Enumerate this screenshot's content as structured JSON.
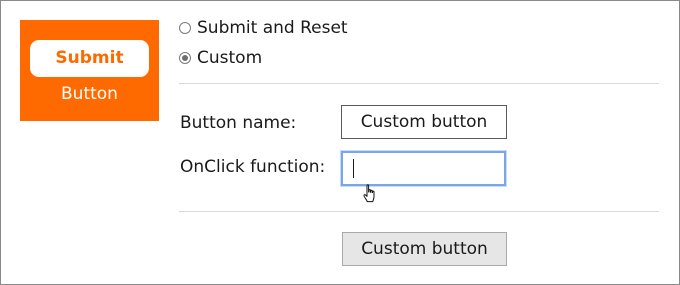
{
  "tile": {
    "pill_label": "Submit",
    "caption": "Button",
    "color": "#ff6a00"
  },
  "options": [
    {
      "label": "Submit and Reset",
      "selected": false
    },
    {
      "label": "Custom",
      "selected": true
    }
  ],
  "form": {
    "button_name_label": "Button name:",
    "button_name_value": "Custom button",
    "onclick_label": "OnClick function:",
    "onclick_value": ""
  },
  "preview": {
    "button_label": "Custom button"
  },
  "icons": {
    "cursor": "hand-pointer-icon"
  }
}
